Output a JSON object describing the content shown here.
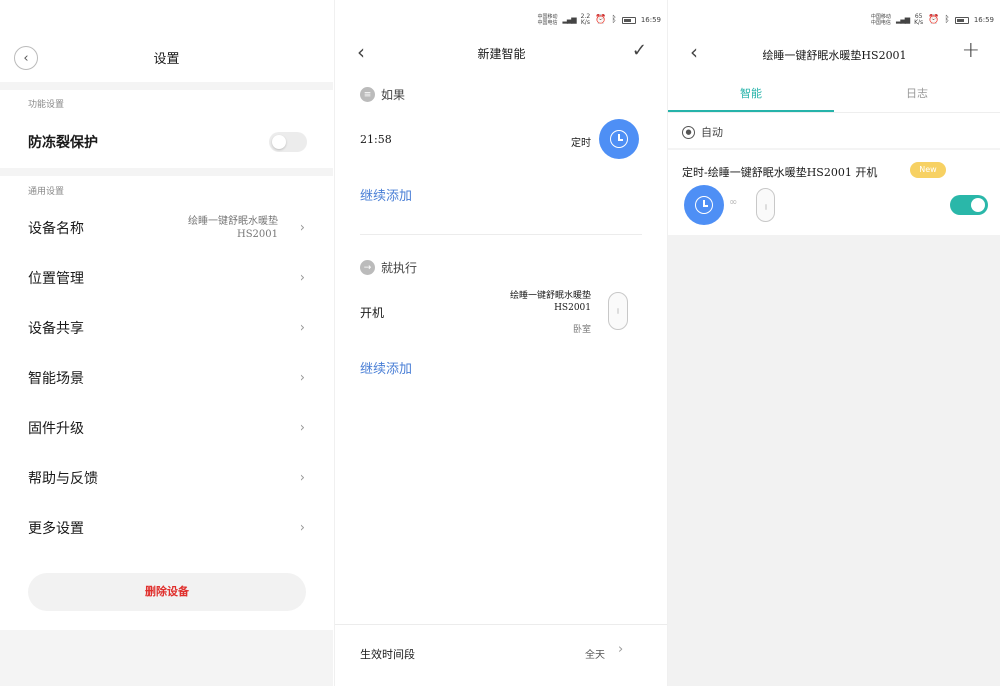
{
  "status_bar": {
    "carrier_1": "中国移动",
    "carrier_2": "中国电信",
    "speed_p2": "2.2",
    "speed_p3": "65",
    "speed_unit": "K/s",
    "time": "16:59"
  },
  "settings": {
    "title": "设置",
    "section_function": "功能设置",
    "antifreeze_label": "防冻裂保护",
    "antifreeze_on": false,
    "section_general": "通用设置",
    "device_name_label": "设备名称",
    "device_name_value": "绘睡一键舒眠水暖垫HS2001",
    "items": [
      {
        "label": "位置管理"
      },
      {
        "label": "设备共享"
      },
      {
        "label": "智能场景"
      },
      {
        "label": "固件升级"
      },
      {
        "label": "帮助与反馈"
      },
      {
        "label": "更多设置"
      }
    ],
    "delete_label": "删除设备"
  },
  "new_smart": {
    "title": "新建智能",
    "if_label": "如果",
    "time_value": "21:58",
    "timer_label": "定时",
    "add_more_1": "继续添加",
    "then_label": "就执行",
    "action_label": "开机",
    "device_name": "绘睡一键舒眠水暖垫HS2001",
    "device_room": "卧室",
    "add_more_2": "继续添加",
    "effective_label": "生效时间段",
    "effective_value": "全天"
  },
  "device_smart": {
    "title": "绘睡一键舒眠水暖垫HS2001",
    "tab_smart": "智能",
    "tab_log": "日志",
    "auto_label": "自动",
    "rule_text": "定时-绘睡一键舒眠水暖垫HS2001 开机",
    "new_badge": "New",
    "rule_enabled": true
  },
  "colors": {
    "blue": "#4e8ff5",
    "teal": "#2ab7a9",
    "red": "#e0302d",
    "badge": "#f7d163"
  }
}
